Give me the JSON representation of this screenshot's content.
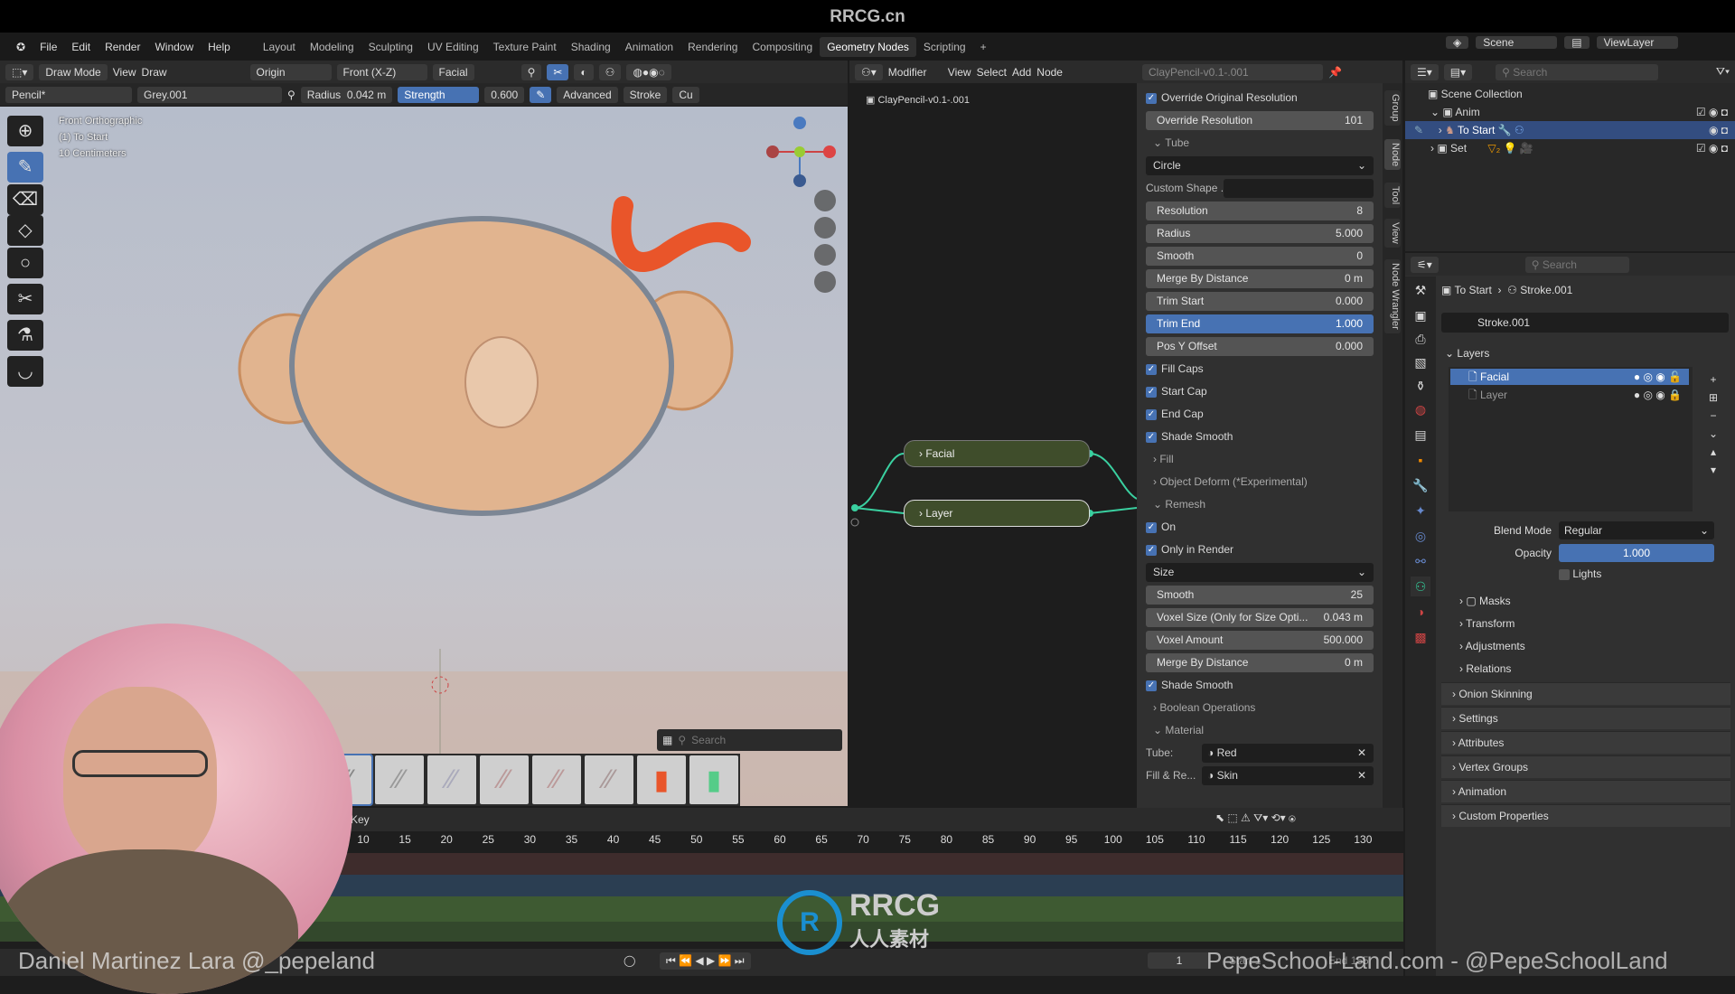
{
  "title": "RRCG.cn",
  "menu": {
    "items": [
      "File",
      "Edit",
      "Render",
      "Window",
      "Help"
    ],
    "workspaces": [
      "Layout",
      "Modeling",
      "Sculpting",
      "UV Editing",
      "Texture Paint",
      "Shading",
      "Animation",
      "Rendering",
      "Compositing",
      "Geometry Nodes",
      "Scripting",
      "+"
    ],
    "active_workspace": "Geometry Nodes",
    "scene": "Scene",
    "view_layer": "ViewLayer"
  },
  "viewport": {
    "header1": {
      "mode": "Draw Mode",
      "view": "View",
      "draw": "Draw",
      "origin": "Origin",
      "view_axis": "Front (X-Z)",
      "layer": "Facial"
    },
    "header2": {
      "brush": "Pencil*",
      "material": "Grey.001",
      "radius_label": "Radius",
      "radius_value": "0.042 m",
      "strength_label": "Strength",
      "strength_value": "0.600",
      "advanced": "Advanced",
      "stroke": "Stroke",
      "cu": "Cu"
    },
    "overlay": [
      "Front Orthographic",
      "(1) To Start",
      "10 Centimeters"
    ],
    "tools": [
      "cursor-icon",
      "draw-brush-icon",
      "eraser-icon",
      "fill-icon",
      "circle-add-icon",
      "cutter-icon",
      "eyedropper-icon",
      "curve-icon"
    ],
    "brush_search_placeholder": "Search",
    "brush_count": 8
  },
  "node_editor": {
    "menu": [
      "Modifier",
      "View",
      "Select",
      "Add",
      "Node"
    ],
    "datablock": "ClayPencil-v0.1-.001",
    "breadcrumb": "ClayPencil-v0.1-.001",
    "nodes": [
      "Facial",
      "Layer"
    ]
  },
  "npanel": {
    "tabs": [
      "Group",
      "Node",
      "Tool",
      "View",
      "Node Wrangler"
    ],
    "rows": [
      {
        "type": "check",
        "label": "Override Original Resolution",
        "checked": true
      },
      {
        "type": "field",
        "label": "Override  Resolution",
        "value": "101"
      },
      {
        "type": "panel",
        "label": "Tube",
        "open": true
      },
      {
        "type": "drop",
        "label": "Circle"
      },
      {
        "type": "custom",
        "label": "Custom Shape ..."
      },
      {
        "type": "field",
        "label": "Resolution",
        "value": "8"
      },
      {
        "type": "field",
        "label": "Radius",
        "value": "5.000"
      },
      {
        "type": "field",
        "label": "Smooth",
        "value": "0"
      },
      {
        "type": "field",
        "label": "Merge By Distance",
        "value": "0 m"
      },
      {
        "type": "field",
        "label": "Trim Start",
        "value": "0.000"
      },
      {
        "type": "field",
        "label": "Trim End",
        "value": "1.000",
        "selected": true
      },
      {
        "type": "field",
        "label": "Pos Y Offset",
        "value": "0.000"
      },
      {
        "type": "check",
        "label": "Fill Caps",
        "checked": true
      },
      {
        "type": "check",
        "label": "Start Cap",
        "checked": true
      },
      {
        "type": "check",
        "label": "End Cap",
        "checked": true
      },
      {
        "type": "check",
        "label": "Shade Smooth",
        "checked": true
      },
      {
        "type": "panel",
        "label": "Fill",
        "open": false
      },
      {
        "type": "panel",
        "label": "Object Deform (*Experimental)",
        "open": false
      },
      {
        "type": "panel",
        "label": "Remesh",
        "open": true
      },
      {
        "type": "check",
        "label": "On",
        "checked": true
      },
      {
        "type": "check",
        "label": "Only in Render",
        "checked": true
      },
      {
        "type": "drop",
        "label": "Size"
      },
      {
        "type": "field",
        "label": "Smooth",
        "value": "25"
      },
      {
        "type": "field",
        "label": "Voxel Size (Only for Size Opti...",
        "value": "0.043 m"
      },
      {
        "type": "field",
        "label": "Voxel Amount",
        "value": "500.000"
      },
      {
        "type": "field",
        "label": "Merge By Distance",
        "value": "0 m"
      },
      {
        "type": "check",
        "label": "Shade Smooth",
        "checked": true
      },
      {
        "type": "panel",
        "label": "Boolean Operations",
        "open": false
      },
      {
        "type": "panel",
        "label": "Material",
        "open": true
      },
      {
        "type": "mat",
        "label": "Tube:",
        "value": "Red"
      },
      {
        "type": "mat",
        "label": "Fill & Re...",
        "value": "Skin"
      }
    ]
  },
  "outliner": {
    "search_placeholder": "Search",
    "root": "Scene Collection",
    "items": [
      {
        "label": "Anim"
      },
      {
        "label": "To Start",
        "selected": true
      },
      {
        "label": "Set"
      }
    ]
  },
  "properties": {
    "search_placeholder": "Search",
    "breadcrumb": [
      "To Start",
      "Stroke.001"
    ],
    "data_name": "Stroke.001",
    "layers_title": "Layers",
    "layers": [
      {
        "label": "Facial",
        "active": true
      },
      {
        "label": "Layer",
        "active": false
      }
    ],
    "blend_mode_label": "Blend Mode",
    "blend_mode": "Regular",
    "opacity_label": "Opacity",
    "opacity": "1.000",
    "lights_label": "Lights",
    "lights": false,
    "layer_subpanels": [
      "Masks",
      "Transform",
      "Adjustments",
      "Relations"
    ],
    "sections": [
      "Onion Skinning",
      "Settings",
      "Attributes",
      "Vertex Groups",
      "Animation",
      "Custom Properties"
    ]
  },
  "timeline": {
    "key_label": "Key",
    "frames": [
      "10",
      "15",
      "20",
      "25",
      "30",
      "35",
      "40",
      "45",
      "50",
      "55",
      "60",
      "65",
      "70",
      "75",
      "80",
      "85",
      "90",
      "95",
      "100",
      "105",
      "110",
      "115",
      "120",
      "125",
      "130"
    ],
    "current_frame": "1",
    "start_label": "Start",
    "start": "1",
    "end_label": "End",
    "end": "155"
  },
  "watermarks": {
    "presenter": "Daniel Martinez Lara @_pepeland",
    "site": "PepeSchool-Land.com - @PepeSchoolLand",
    "logo": "RRCG 人人素材"
  },
  "colors": {
    "accent": "#4772b3",
    "node": "#3f4d2b",
    "head": "#e1b48f",
    "tail": "#e9552a"
  }
}
